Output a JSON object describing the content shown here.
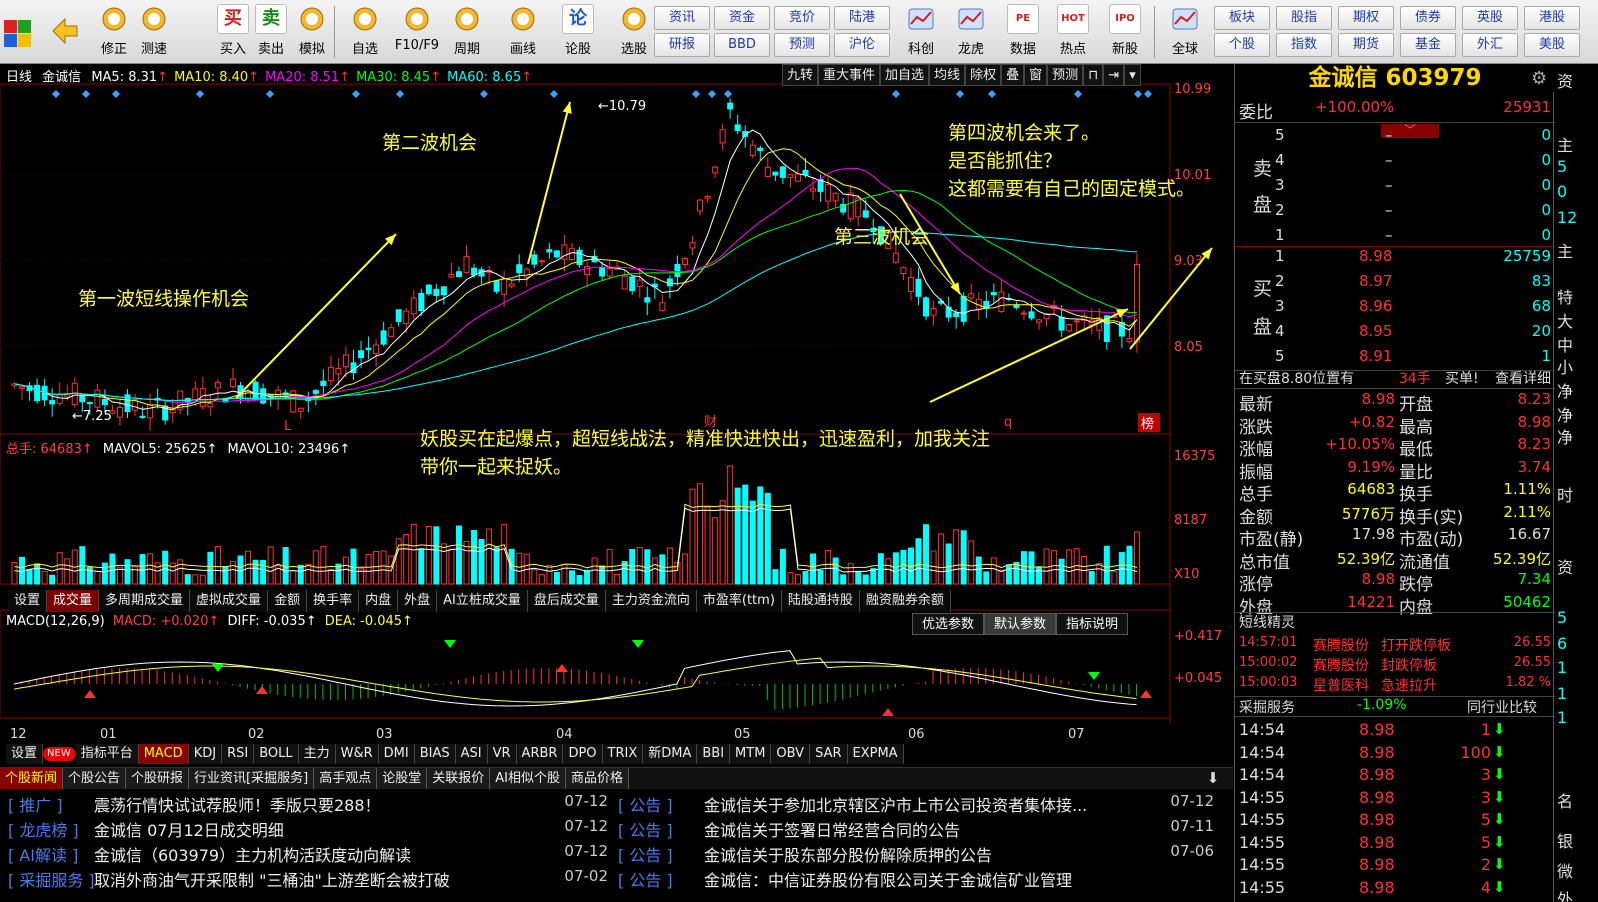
{
  "toolbar": {
    "buttons": [
      {
        "label": "",
        "icon": "back-arrow-icon"
      },
      {
        "label": "修正",
        "icon": "up-down-icon"
      },
      {
        "label": "测速",
        "icon": "speed-icon"
      },
      {
        "label": "买入",
        "icon": "buy-icon",
        "glyph": "买"
      },
      {
        "label": "卖出",
        "icon": "sell-icon",
        "glyph": "卖"
      },
      {
        "label": "模拟",
        "icon": "hammer-icon"
      },
      {
        "label": "自选",
        "icon": "star-icon"
      },
      {
        "label": "F10/F9",
        "icon": "info-icon"
      },
      {
        "label": "周期",
        "icon": "clock-icon"
      },
      {
        "label": "画线",
        "icon": "pencil-icon"
      },
      {
        "label": "论股",
        "icon": "discuss-icon",
        "glyph": "论"
      },
      {
        "label": "选股",
        "icon": "search-chart-icon"
      }
    ],
    "grid_left": [
      [
        "资讯",
        "资金",
        "竞价",
        "陆港"
      ],
      [
        "研报",
        "BBD",
        "预测",
        "沪伦"
      ]
    ],
    "mid_buttons": [
      {
        "label": "科创",
        "icon": "chart-icon"
      },
      {
        "label": "龙虎",
        "icon": "dragon-icon"
      },
      {
        "label": "数据",
        "icon": "pe-icon",
        "glyph": "PE"
      },
      {
        "label": "热点",
        "icon": "hot-icon",
        "glyph": "HOT"
      },
      {
        "label": "新股",
        "icon": "ipo-icon",
        "glyph": "IPO"
      },
      {
        "label": "全球",
        "icon": "globe-icon"
      }
    ],
    "grid_right": [
      [
        "板块",
        "股指",
        "期权",
        "债券",
        "英股",
        "港股"
      ],
      [
        "个股",
        "指数",
        "期货",
        "基金",
        "外汇",
        "美股"
      ]
    ]
  },
  "chart": {
    "period": "日线",
    "stock": "金诚信",
    "ma": [
      {
        "text": "MA5: 8.31",
        "color": "#ffffff"
      },
      {
        "text": "MA10: 8.40",
        "color": "#ffff00"
      },
      {
        "text": "MA20: 8.51",
        "color": "#ff00ff"
      },
      {
        "text": "MA30: 8.45",
        "color": "#00ff00"
      },
      {
        "text": "MA60: 8.65",
        "color": "#00ffff"
      }
    ],
    "top_buttons": [
      "九转",
      "重大事件",
      "加自选",
      "均线",
      "除权",
      "叠",
      "窗",
      "预测",
      "⊓",
      "⇥",
      "▾"
    ],
    "price_ticks": [
      "10.99",
      "10.01",
      "9.03",
      "8.05"
    ],
    "high_label": "10.79",
    "low_label": "7.25",
    "markers": [
      "L",
      "财",
      "q",
      "榜"
    ],
    "annotations": [
      "第一波短线操作机会",
      "第二波机会",
      "第三波机会",
      "第四波机会来了。",
      "是否能抓住？",
      "这都需要有自己的固定模式。",
      "妖股买在起爆点，超短线战法，精准快进快出，迅速盈利，加我关注",
      "带你一起来捉妖。"
    ],
    "volume_header": [
      "总手: 64683↑",
      "MAVOL5: 25625↑",
      "MAVOL10: 23496↑"
    ],
    "volume_ticks": [
      "16375",
      "8187",
      "X10"
    ],
    "volume_tabs": [
      "设置",
      "成交量",
      "多周期成交量",
      "虚拟成交量",
      "金额",
      "换手率",
      "内盘",
      "外盘",
      "AI立桩成交量",
      "盘后成交量",
      "主力资金流向",
      "市盈率(ttm)",
      "陆股通持股",
      "融资融券余额"
    ],
    "macd_header": [
      "MACD(12,26,9)",
      "MACD: +0.020↑",
      "DIFF: -0.035↑",
      "DEA: -0.045↑"
    ],
    "macd_buttons": [
      "优选参数",
      "默认参数",
      "指标说明"
    ],
    "macd_ticks": [
      "+0.417",
      "+0.045"
    ],
    "dates": [
      "12",
      "01",
      "02",
      "03",
      "04",
      "05",
      "06",
      "07"
    ],
    "bottom_tabs": [
      "设置",
      "NEW",
      "指标平台",
      "MACD",
      "KDJ",
      "RSI",
      "BOLL",
      "主力",
      "W&R",
      "DMI",
      "BIAS",
      "ASI",
      "VR",
      "ARBR",
      "DPO",
      "TRIX",
      "新DMA",
      "BBI",
      "MTM",
      "OBV",
      "SAR",
      "EXPMA"
    ]
  },
  "news_tabs": [
    "个股新闻",
    "个股公告",
    "个股研报",
    "行业资讯[采掘服务]",
    "高手观点",
    "论股堂",
    "关联报价",
    "AI相似个股",
    "商品价格"
  ],
  "news": [
    {
      "tag": "[ 推广 ]",
      "title": "震荡行情快试试荐股师！季版只要288！",
      "date": "07-12",
      "tag2": "[ 公告 ]",
      "title2": "金诚信关于参加北京辖区沪市上市公司投资者集体接...",
      "date2": "07-12"
    },
    {
      "tag": "[ 龙虎榜 ]",
      "title": "金诚信 07月12日成交明细",
      "date": "07-12",
      "tag2": "[ 公告 ]",
      "title2": "金诚信关于签署日常经营合同的公告",
      "date2": "07-11"
    },
    {
      "tag": "[ AI解读 ]",
      "title": "金诚信（603979）主力机构活跃度动向解读",
      "date": "07-12",
      "tag2": "[ 公告 ]",
      "title2": "金诚信关于股东部分股份解除质押的公告",
      "date2": "07-06"
    },
    {
      "tag": "[ 采掘服务 ]",
      "title": "取消外商油气开采限制 \"三桶油\"上游垄断会被打破",
      "date": "07-02",
      "tag2": "[ 公告 ]",
      "title2": "金诚信：中信证券股份有限公司关于金诚信矿业管理",
      "date2": ""
    }
  ],
  "panel": {
    "title": "金诚信 603979",
    "weibi_label": "委比",
    "weibi_pct": "+100.00%",
    "weibi_val": "25931",
    "sell_side_label": [
      "卖",
      "盘"
    ],
    "buy_side_label": [
      "买",
      "盘"
    ],
    "sell": [
      {
        "n": "5",
        "price": "–",
        "vol": "0"
      },
      {
        "n": "4",
        "price": "–",
        "vol": "0"
      },
      {
        "n": "3",
        "price": "–",
        "vol": "0"
      },
      {
        "n": "2",
        "price": "–",
        "vol": "0"
      },
      {
        "n": "1",
        "price": "–",
        "vol": "0"
      }
    ],
    "buy": [
      {
        "n": "1",
        "price": "8.98",
        "vol": "25759"
      },
      {
        "n": "2",
        "price": "8.97",
        "vol": "83"
      },
      {
        "n": "3",
        "price": "8.96",
        "vol": "68"
      },
      {
        "n": "4",
        "price": "8.95",
        "vol": "20"
      },
      {
        "n": "5",
        "price": "8.91",
        "vol": "1"
      }
    ],
    "inbuy": {
      "text": "在买盘8.80位置有",
      "qty": "34手",
      "act": "买单!",
      "detail": "查看详细"
    },
    "stats": [
      {
        "l1": "最新",
        "v1": "8.98",
        "c1": "red",
        "l2": "开盘",
        "v2": "8.23",
        "c2": "red"
      },
      {
        "l1": "涨跌",
        "v1": "+0.82",
        "c1": "red",
        "l2": "最高",
        "v2": "8.98",
        "c2": "red"
      },
      {
        "l1": "涨幅",
        "v1": "+10.05%",
        "c1": "red",
        "l2": "最低",
        "v2": "8.23",
        "c2": "red"
      },
      {
        "l1": "振幅",
        "v1": "9.19%",
        "c1": "red",
        "l2": "量比",
        "v2": "3.74",
        "c2": "red"
      },
      {
        "l1": "总手",
        "v1": "64683",
        "c1": "yellow",
        "l2": "换手",
        "v2": "1.11%",
        "c2": "yellow"
      },
      {
        "l1": "金额",
        "v1": "5776万",
        "c1": "yellow",
        "l2": "换手(实)",
        "v2": "2.11%",
        "c2": "yellow"
      },
      {
        "l1": "市盈(静)",
        "v1": "17.98",
        "c1": "white",
        "l2": "市盈(动)",
        "v2": "16.67",
        "c2": "white"
      },
      {
        "l1": "总市值",
        "v1": "52.39亿",
        "c1": "yellow",
        "l2": "流通值",
        "v2": "52.39亿",
        "c2": "yellow"
      },
      {
        "l1": "涨停",
        "v1": "8.98",
        "c1": "red",
        "l2": "跌停",
        "v2": "7.34",
        "c2": "green"
      },
      {
        "l1": "外盘",
        "v1": "14221",
        "c1": "red",
        "l2": "内盘",
        "v2": "50462",
        "c2": "green"
      }
    ],
    "jingling_title": "短线精灵",
    "jingling": [
      {
        "time": "14:57:01",
        "name": "赛腾股份",
        "act": "打开跌停板",
        "val": "26.55"
      },
      {
        "time": "15:00:02",
        "name": "赛腾股份",
        "act": "封跌停板",
        "val": "26.55"
      },
      {
        "time": "15:00:03",
        "name": "星普医科",
        "act": "急速拉升",
        "val": "1.82 %"
      }
    ],
    "industry": {
      "name": "采掘服务",
      "pct": "-1.09%",
      "cmp": "同行业比较"
    },
    "ticks": [
      {
        "t": "14:54",
        "p": "8.98",
        "v": "1"
      },
      {
        "t": "14:54",
        "p": "8.98",
        "v": "100"
      },
      {
        "t": "14:54",
        "p": "8.98",
        "v": "3"
      },
      {
        "t": "14:55",
        "p": "8.98",
        "v": "3"
      },
      {
        "t": "14:55",
        "p": "8.98",
        "v": "5"
      },
      {
        "t": "14:55",
        "p": "8.98",
        "v": "5"
      },
      {
        "t": "14:55",
        "p": "8.98",
        "v": "2"
      },
      {
        "t": "14:55",
        "p": "8.98",
        "v": "4"
      }
    ],
    "edge_chars": [
      "资",
      "主",
      "5",
      "0",
      "12",
      "主",
      "特",
      "大",
      "中",
      "小",
      "净",
      "净",
      "净",
      "时",
      "资",
      "5",
      "6",
      "1",
      "1",
      "1",
      "名",
      "银",
      "微",
      "外"
    ]
  },
  "colors": {
    "up": "#ff3030",
    "down": "#00ffff",
    "ma5": "#ffffff",
    "ma10": "#ffff00",
    "ma20": "#ff00ff",
    "ma30": "#00ff00",
    "ma60": "#00ffff",
    "annotation": "#ffff33",
    "title": "#ffd700"
  },
  "chart_data": {
    "type": "candlestick",
    "price_axis_ticks": [
      10.99,
      10.01,
      9.03,
      8.05
    ],
    "high": 10.79,
    "low": 7.25,
    "last_close": 8.98,
    "months": [
      "12",
      "01",
      "02",
      "03",
      "04",
      "05",
      "06",
      "07"
    ],
    "volume_axis_ticks": [
      16375,
      8187
    ],
    "macd_axis_ticks": [
      0.417,
      0.045
    ]
  }
}
